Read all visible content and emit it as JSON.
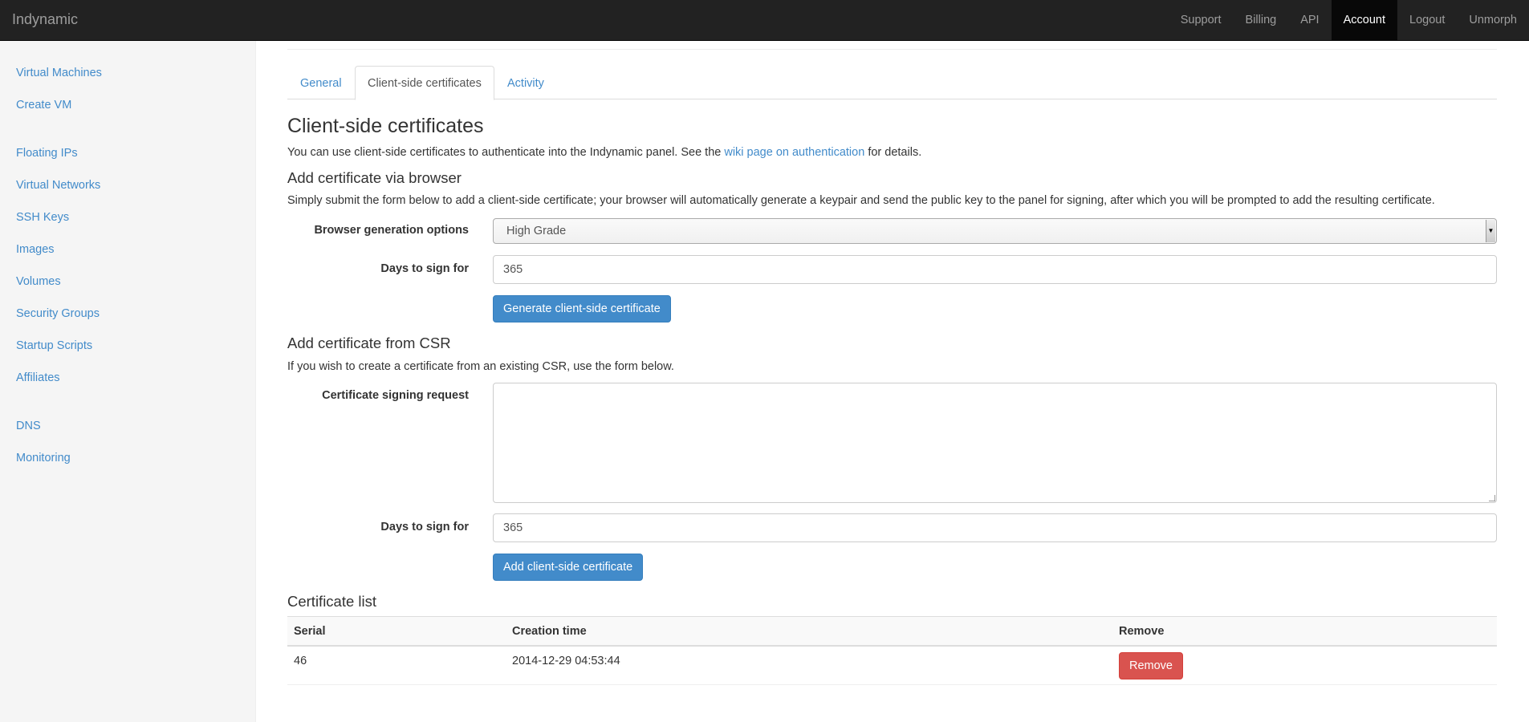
{
  "navbar": {
    "brand": "Indynamic",
    "items": [
      {
        "label": "Support",
        "active": false
      },
      {
        "label": "Billing",
        "active": false
      },
      {
        "label": "API",
        "active": false
      },
      {
        "label": "Account",
        "active": true
      },
      {
        "label": "Logout",
        "active": false
      },
      {
        "label": "Unmorph",
        "active": false
      }
    ]
  },
  "sidebar": {
    "items": [
      {
        "label": "Virtual Machines"
      },
      {
        "label": "Create VM"
      },
      {
        "label": "Floating IPs"
      },
      {
        "label": "Virtual Networks"
      },
      {
        "label": "SSH Keys"
      },
      {
        "label": "Images"
      },
      {
        "label": "Volumes"
      },
      {
        "label": "Security Groups"
      },
      {
        "label": "Startup Scripts"
      },
      {
        "label": "Affiliates"
      },
      {
        "label": "DNS"
      },
      {
        "label": "Monitoring"
      }
    ]
  },
  "tabs": [
    {
      "label": "General",
      "active": false
    },
    {
      "label": "Client-side certificates",
      "active": true
    },
    {
      "label": "Activity",
      "active": false
    }
  ],
  "main": {
    "title": "Client-side certificates",
    "intro_before": "You can use client-side certificates to authenticate into the Indynamic panel. See the ",
    "intro_link": "wiki page on authentication",
    "intro_after": " for details.",
    "browser_section": {
      "heading": "Add certificate via browser",
      "description": "Simply submit the form below to add a client-side certificate; your browser will automatically generate a keypair and send the public key to the panel for signing, after which you will be prompted to add the resulting certificate.",
      "options_label": "Browser generation options",
      "options_value": "High Grade",
      "days_label": "Days to sign for",
      "days_value": "365",
      "submit_label": "Generate client-side certificate"
    },
    "csr_section": {
      "heading": "Add certificate from CSR",
      "description": "If you wish to create a certificate from an existing CSR, use the form below.",
      "csr_label": "Certificate signing request",
      "csr_value": "",
      "days_label": "Days to sign for",
      "days_value": "365",
      "submit_label": "Add client-side certificate"
    },
    "list_section": {
      "heading": "Certificate list",
      "columns": [
        "Serial",
        "Creation time",
        "Remove"
      ],
      "rows": [
        {
          "serial": "46",
          "created": "2014-12-29 04:53:44",
          "remove_label": "Remove"
        }
      ]
    }
  },
  "colors": {
    "link": "#428bca",
    "primary_button": "#428bca",
    "danger_button": "#d9534f",
    "navbar": "#222222",
    "sidebar": "#f5f5f5"
  }
}
